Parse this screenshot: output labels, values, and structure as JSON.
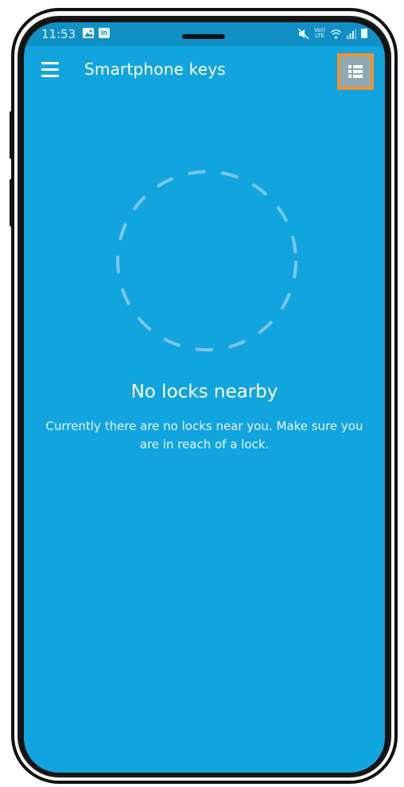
{
  "status_bar": {
    "time": "11:53",
    "left_icons": [
      "image-icon",
      "linkedin-icon"
    ],
    "right_icons": [
      "mute-icon",
      "volte-icon",
      "wifi-icon",
      "signal-icon",
      "battery-icon"
    ],
    "volte_label": "Vo))",
    "lte_label": "LTE"
  },
  "app_bar": {
    "menu_icon": "hamburger-menu-icon",
    "title": "Smartphone keys",
    "list_view_icon": "list-view-icon",
    "list_view_highlighted": true
  },
  "empty_state": {
    "icon": "dashed-circle-icon",
    "title": "No locks nearby",
    "description": "Currently there are no locks near you. Make sure you are in reach of a lock."
  },
  "colors": {
    "screen_background": "#12A4DE",
    "status_bar_background": "#1190C6",
    "highlight_border": "#F0922E",
    "highlight_fill": "#8FA9B3",
    "dashed_circle": "#7CC8EC",
    "text": "#FFFFFF"
  }
}
